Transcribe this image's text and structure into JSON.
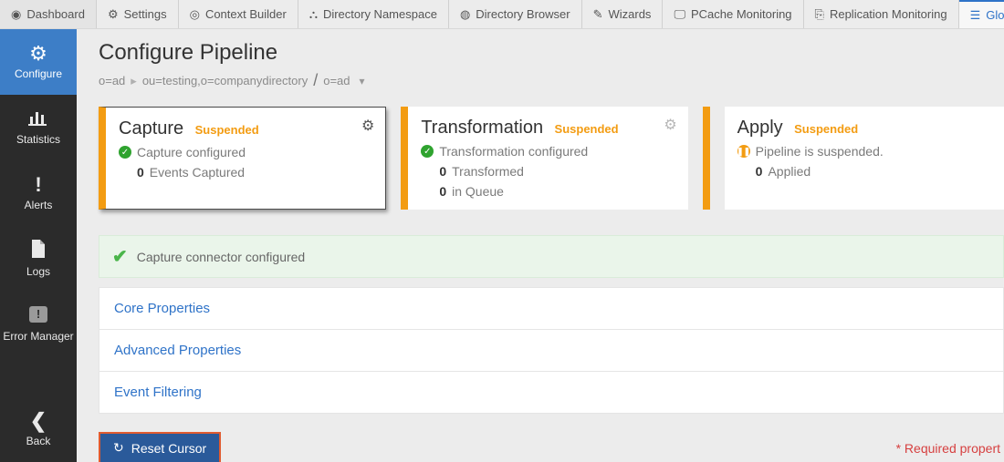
{
  "tabs": [
    {
      "label": "Dashboard",
      "icon": "◉"
    },
    {
      "label": "Settings",
      "icon": "⚙"
    },
    {
      "label": "Context Builder",
      "icon": "◎"
    },
    {
      "label": "Directory Namespace",
      "icon": "⛬"
    },
    {
      "label": "Directory Browser",
      "icon": "◍"
    },
    {
      "label": "Wizards",
      "icon": "✎"
    },
    {
      "label": "PCache Monitoring",
      "icon": "🖵"
    },
    {
      "label": "Replication Monitoring",
      "icon": "⎘"
    },
    {
      "label": "Global Sync",
      "icon": "☰"
    }
  ],
  "sidebar": {
    "configure": "Configure",
    "statistics": "Statistics",
    "alerts": "Alerts",
    "logs": "Logs",
    "error_manager": "Error Manager",
    "back": "Back"
  },
  "page": {
    "title": "Configure Pipeline",
    "breadcrumb": {
      "seg1": "o=ad",
      "seg2": "ou=testing,o=companydirectory",
      "seg3": "o=ad"
    }
  },
  "cards": {
    "capture": {
      "title": "Capture",
      "status": "Suspended",
      "line1": "Capture configured",
      "count1": "0",
      "count1_label": "Events Captured"
    },
    "transformation": {
      "title": "Transformation",
      "status": "Suspended",
      "line1": "Transformation configured",
      "count1": "0",
      "count1_label": "Transformed",
      "count2": "0",
      "count2_label": "in Queue"
    },
    "apply": {
      "title": "Apply",
      "status": "Suspended",
      "line1": "Pipeline is suspended.",
      "count1": "0",
      "count1_label": "Applied"
    }
  },
  "banner": {
    "text": "Capture connector configured"
  },
  "accordions": {
    "core": "Core Properties",
    "advanced": "Advanced Properties",
    "events": "Event Filtering"
  },
  "footer": {
    "reset": "Reset Cursor",
    "required": "* Required propert"
  }
}
